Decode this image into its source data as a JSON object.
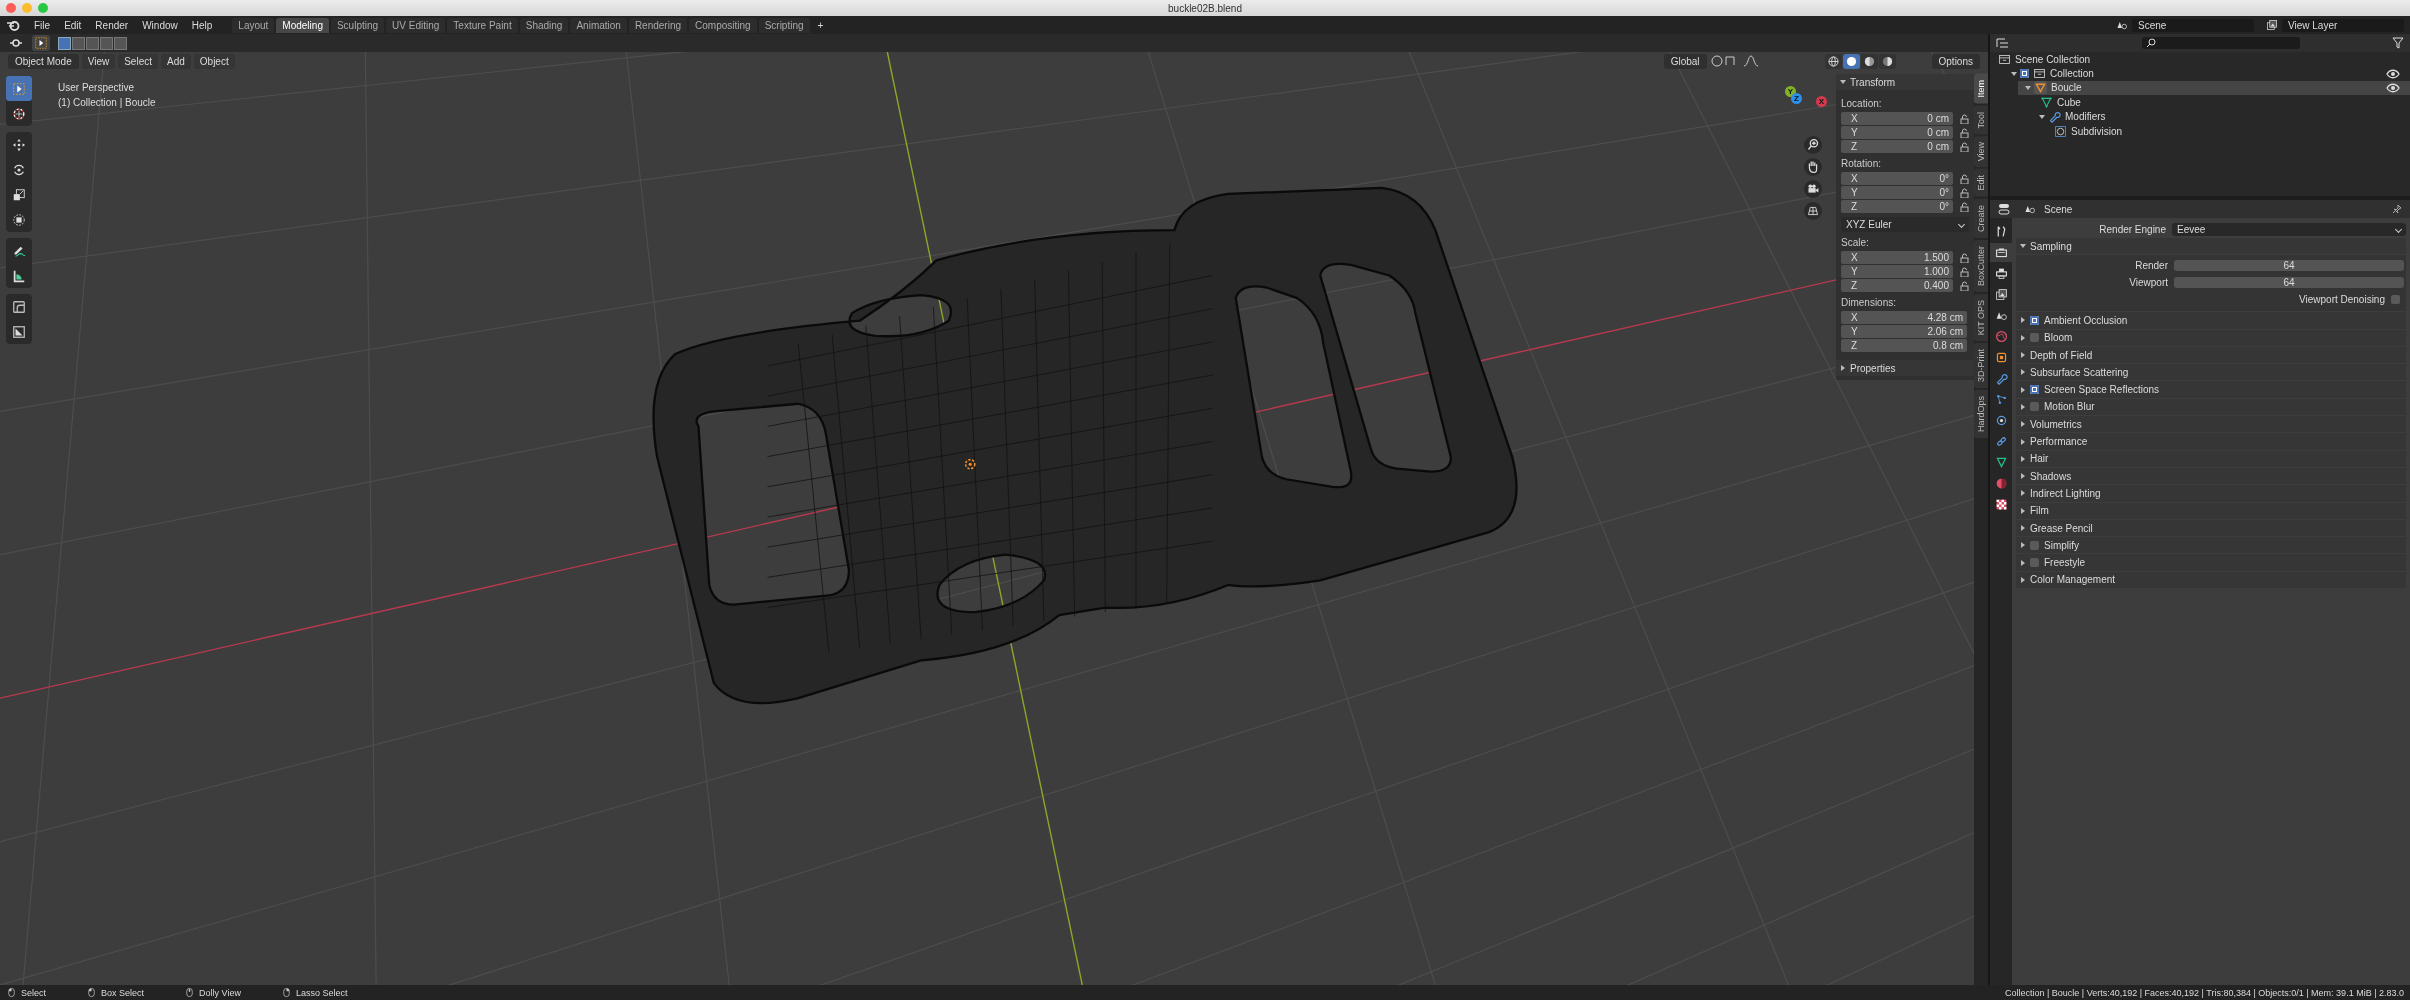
{
  "window": {
    "title": "buckle02B.blend"
  },
  "menu": [
    "File",
    "Edit",
    "Render",
    "Window",
    "Help"
  ],
  "workspaces": [
    {
      "label": "Layout",
      "selected": false
    },
    {
      "label": "Modeling",
      "selected": true
    },
    {
      "label": "Sculpting",
      "selected": false
    },
    {
      "label": "UV Editing",
      "selected": false
    },
    {
      "label": "Texture Paint",
      "selected": false
    },
    {
      "label": "Shading",
      "selected": false
    },
    {
      "label": "Animation",
      "selected": false
    },
    {
      "label": "Rendering",
      "selected": false
    },
    {
      "label": "Compositing",
      "selected": false
    },
    {
      "label": "Scripting",
      "selected": false
    }
  ],
  "add_workspace": "+",
  "scene": "Scene",
  "view_layer": "View Layer",
  "select_modes": [
    {
      "selected": true
    },
    {
      "selected": false
    },
    {
      "selected": false
    },
    {
      "selected": false
    },
    {
      "selected": false
    }
  ],
  "viewport_header": {
    "mode": "Object Mode",
    "menus": [
      "View",
      "Select",
      "Add",
      "Object"
    ],
    "orientation": "Global",
    "options": "Options"
  },
  "shading_modes": [
    {
      "kind": "wireframe",
      "selected": false
    },
    {
      "kind": "solid",
      "selected": true
    },
    {
      "kind": "material",
      "selected": false
    },
    {
      "kind": "rendered",
      "selected": false
    }
  ],
  "viewport": {
    "view_name": "User Perspective",
    "context": "(1) Collection | Boucle"
  },
  "gizmo": [
    {
      "label": "X",
      "color": "#d5384f"
    },
    {
      "label": "Y",
      "color": "#82b326"
    },
    {
      "label": "Z",
      "color": "#2e8fe8"
    }
  ],
  "tool_groups": [
    [
      {
        "kind": "select_box",
        "selected": true
      },
      {
        "kind": "cursor",
        "selected": false
      }
    ],
    [
      {
        "kind": "move",
        "selected": false
      },
      {
        "kind": "rotate",
        "selected": false
      },
      {
        "kind": "scale",
        "selected": false
      },
      {
        "kind": "transform",
        "selected": false
      }
    ],
    [
      {
        "kind": "annotate",
        "selected": false
      },
      {
        "kind": "measure",
        "selected": false
      }
    ],
    [
      {
        "kind": "bevel_corner",
        "selected": false
      },
      {
        "kind": "cutter",
        "selected": false
      }
    ]
  ],
  "n_panel": {
    "tabs": [
      {
        "label": "Item",
        "selected": true
      },
      {
        "label": "Tool",
        "selected": false
      },
      {
        "label": "View",
        "selected": false
      },
      {
        "label": "Edit",
        "selected": false
      },
      {
        "label": "Create",
        "selected": false
      },
      {
        "label": "BoxCutter",
        "selected": false
      },
      {
        "label": "KIT OPS",
        "selected": false
      },
      {
        "label": "3D-Print",
        "selected": false
      },
      {
        "label": "HardOps",
        "selected": false
      }
    ],
    "transform": {
      "title": "Transform",
      "expanded": true,
      "groups": [
        {
          "kind": "vector",
          "label": "Location:",
          "lockable": true,
          "fields": [
            {
              "axis": "X",
              "value": "0 cm"
            },
            {
              "axis": "Y",
              "value": "0 cm"
            },
            {
              "axis": "Z",
              "value": "0 cm"
            }
          ]
        },
        {
          "kind": "vector",
          "label": "Rotation:",
          "lockable": true,
          "fields": [
            {
              "axis": "X",
              "value": "0°"
            },
            {
              "axis": "Y",
              "value": "0°"
            },
            {
              "axis": "Z",
              "value": "0°"
            }
          ]
        },
        {
          "kind": "dropdown",
          "value": "XYZ Euler"
        },
        {
          "kind": "vector",
          "label": "Scale:",
          "lockable": true,
          "fields": [
            {
              "axis": "X",
              "value": "1.500"
            },
            {
              "axis": "Y",
              "value": "1.000"
            },
            {
              "axis": "Z",
              "value": "0.400"
            }
          ]
        },
        {
          "kind": "vector",
          "label": "Dimensions:",
          "lockable": false,
          "fields": [
            {
              "axis": "X",
              "value": "4.28 cm"
            },
            {
              "axis": "Y",
              "value": "2.06 cm"
            },
            {
              "axis": "Z",
              "value": "0.8 cm"
            }
          ]
        }
      ]
    },
    "properties": {
      "title": "Properties",
      "expanded": false
    }
  },
  "outliner": {
    "tree": [
      {
        "label": "Scene Collection",
        "kind": "scene_collection",
        "selected": false,
        "children": [
          {
            "label": "Collection",
            "kind": "collection",
            "checked": true,
            "visible": true,
            "expanded": true,
            "selected": false,
            "children": [
              {
                "label": "Boucle",
                "kind": "mesh_object",
                "visible": true,
                "expanded": true,
                "selected": true,
                "children": [
                  {
                    "label": "Cube",
                    "kind": "mesh_data",
                    "selected": false
                  },
                  {
                    "label": "Modifiers",
                    "kind": "modifiers",
                    "expanded": true,
                    "selected": false,
                    "children": [
                      {
                        "label": "Subdivision",
                        "kind": "subdivision",
                        "selected": false
                      }
                    ]
                  }
                ]
              }
            ]
          }
        ]
      }
    ]
  },
  "properties": {
    "context": "Scene",
    "tabs": [
      {
        "kind": "tool",
        "selected": false
      },
      {
        "kind": "render",
        "selected": true
      },
      {
        "kind": "output",
        "selected": false
      },
      {
        "kind": "view_layer",
        "selected": false
      },
      {
        "kind": "scene",
        "selected": false
      },
      {
        "kind": "world",
        "selected": false
      },
      {
        "kind": "object",
        "selected": false
      },
      {
        "kind": "modifiers",
        "selected": false
      },
      {
        "kind": "particles",
        "selected": false
      },
      {
        "kind": "physics",
        "selected": false
      },
      {
        "kind": "constraints",
        "selected": false
      },
      {
        "kind": "data",
        "selected": false
      },
      {
        "kind": "material",
        "selected": false
      },
      {
        "kind": "texture",
        "selected": false
      }
    ],
    "render_engine": {
      "label": "Render Engine",
      "value": "Eevee"
    },
    "sampling": {
      "title": "Sampling",
      "expanded": true,
      "fields": [
        {
          "label": "Render",
          "value": "64"
        },
        {
          "label": "Viewport",
          "value": "64"
        }
      ],
      "denoising": {
        "label": "Viewport Denoising",
        "checked": false
      }
    },
    "panels": [
      {
        "title": "Ambient Occlusion",
        "kind": "toggle",
        "checked": true
      },
      {
        "title": "Bloom",
        "kind": "toggle",
        "checked": false
      },
      {
        "title": "Depth of Field",
        "kind": "plain"
      },
      {
        "title": "Subsurface Scattering",
        "kind": "plain"
      },
      {
        "title": "Screen Space Reflections",
        "kind": "toggle",
        "checked": true
      },
      {
        "title": "Motion Blur",
        "kind": "toggle",
        "checked": false
      },
      {
        "title": "Volumetrics",
        "kind": "plain"
      },
      {
        "title": "Performance",
        "kind": "plain"
      },
      {
        "title": "Hair",
        "kind": "plain"
      },
      {
        "title": "Shadows",
        "kind": "plain"
      },
      {
        "title": "Indirect Lighting",
        "kind": "plain"
      },
      {
        "title": "Film",
        "kind": "plain"
      },
      {
        "title": "Grease Pencil",
        "kind": "plain"
      },
      {
        "title": "Simplify",
        "kind": "toggle",
        "checked": false
      },
      {
        "title": "Freestyle",
        "kind": "toggle",
        "checked": false
      },
      {
        "title": "Color Management",
        "kind": "plain"
      }
    ]
  },
  "status_bar": {
    "hints": [
      {
        "kind": "mouse_left",
        "label": "Select"
      },
      {
        "kind": "mouse_left",
        "label": "Box Select"
      },
      {
        "kind": "mouse_middle",
        "label": "Dolly View"
      },
      {
        "kind": "mouse_right",
        "label": "Lasso Select"
      }
    ],
    "stats": "Collection | Boucle | Verts:40,192 | Faces:40,192 | Tris:80,384 | Objects:0/1 | Mem: 39.1 MiB | 2.83.0"
  }
}
